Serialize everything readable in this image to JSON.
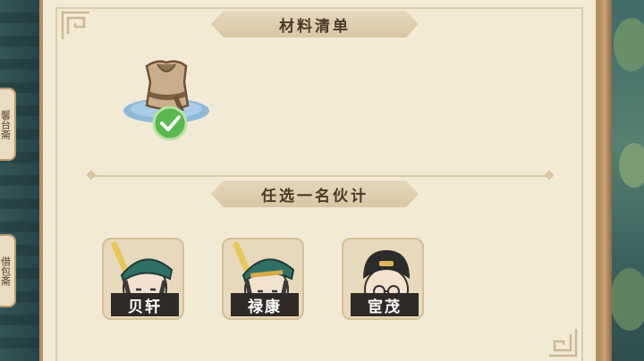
{
  "left_side_tabs": [
    {
      "label": "馨台斋"
    },
    {
      "label": "借包斋"
    }
  ],
  "materials_section": {
    "title": "材料清单",
    "items": [
      {
        "icon": "cloth-vest-icon",
        "status": "checked"
      }
    ]
  },
  "companions_section": {
    "title": "任选一名伙计",
    "companions": [
      {
        "name": "贝轩",
        "hat_color": "#2f6f66"
      },
      {
        "name": "禄康",
        "hat_color": "#2f6f66"
      },
      {
        "name": "宦茂",
        "hat_color": "#2b2b2b"
      }
    ]
  },
  "colors": {
    "panel_bg": "#f3ead6",
    "banner_bg": "#e4d7bb",
    "name_plate": "#2f2a28",
    "check_green": "#3fa43a"
  }
}
